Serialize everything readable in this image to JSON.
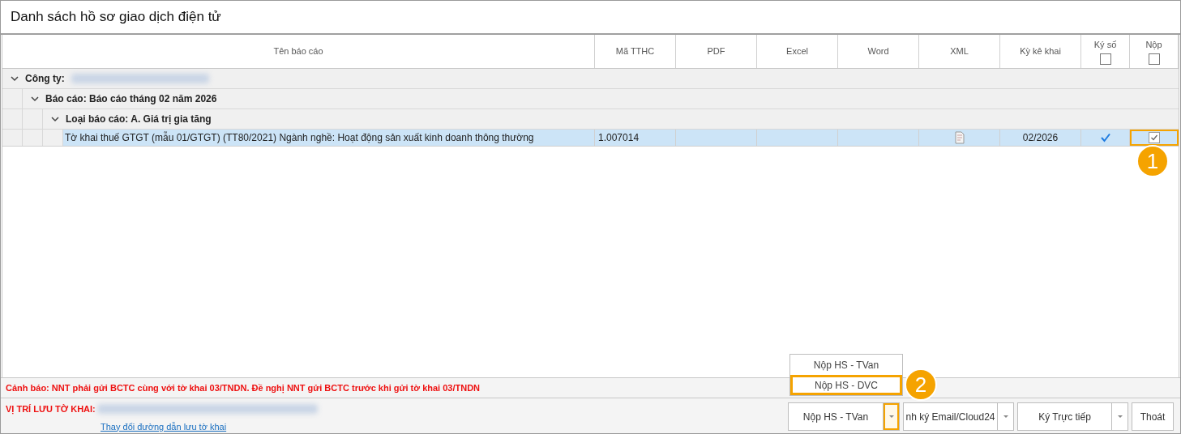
{
  "window": {
    "title": "Danh sách hồ sơ giao dịch điện tử"
  },
  "table": {
    "columns": [
      {
        "label": "Tên báo cáo",
        "kind": "text"
      },
      {
        "label": "Mã TTHC",
        "kind": "text"
      },
      {
        "label": "PDF",
        "kind": "text"
      },
      {
        "label": "Excel",
        "kind": "text"
      },
      {
        "label": "Word",
        "kind": "text"
      },
      {
        "label": "XML",
        "kind": "text"
      },
      {
        "label": "Kỳ kê khai",
        "kind": "text"
      },
      {
        "label": "Ký số",
        "kind": "checkbox",
        "checked": false
      },
      {
        "label": "Nộp",
        "kind": "checkbox",
        "checked": false
      }
    ],
    "groups": [
      {
        "label": "Công ty:",
        "redacted": true,
        "expanded": true,
        "children": [
          {
            "label": "Báo cáo: Báo cáo tháng 02 năm 2026",
            "expanded": true,
            "children": [
              {
                "label": "Loại báo cáo: A. Giá trị gia tăng",
                "expanded": true,
                "rows": [
                  {
                    "selected": true,
                    "name": "Tờ khai thuế GTGT (mẫu 01/GTGT) (TT80/2021) Ngành nghề: Hoạt động sản xuất kinh doanh thông thường",
                    "code": "1.007014",
                    "xml_file": true,
                    "period": "02/2026",
                    "signed": true,
                    "submit": true,
                    "submit_highlighted": true
                  }
                ]
              }
            ]
          }
        ]
      }
    ]
  },
  "warning": "Cảnh báo: NNT phải gửi BCTC cùng với tờ khai 03/TNDN. Đề nghị NNT gửi BCTC trước khi gửi tờ khai 03/TNDN",
  "save_location": {
    "label": "VỊ TRÍ LƯU TỜ KHAI:",
    "redacted": true,
    "link": "Thay đổi đường dẫn lưu tờ khai"
  },
  "buttons": [
    {
      "label": "Nộp HS - TVan",
      "kind": "split",
      "arrow_highlighted": true
    },
    {
      "label": "nh ký Email/Cloud24",
      "kind": "split",
      "arrow_highlighted": false
    },
    {
      "label": "Ký Trực tiếp",
      "kind": "split",
      "arrow_highlighted": false
    },
    {
      "label": "Thoát",
      "kind": "plain",
      "arrow_highlighted": false
    }
  ],
  "dropdown_menu": {
    "items": [
      {
        "label": "Nộp HS - TVan",
        "highlighted": false
      },
      {
        "label": "Nộp HS - DVC",
        "highlighted": true
      }
    ]
  },
  "annotations": [
    {
      "label": "1"
    },
    {
      "label": "2"
    }
  ]
}
